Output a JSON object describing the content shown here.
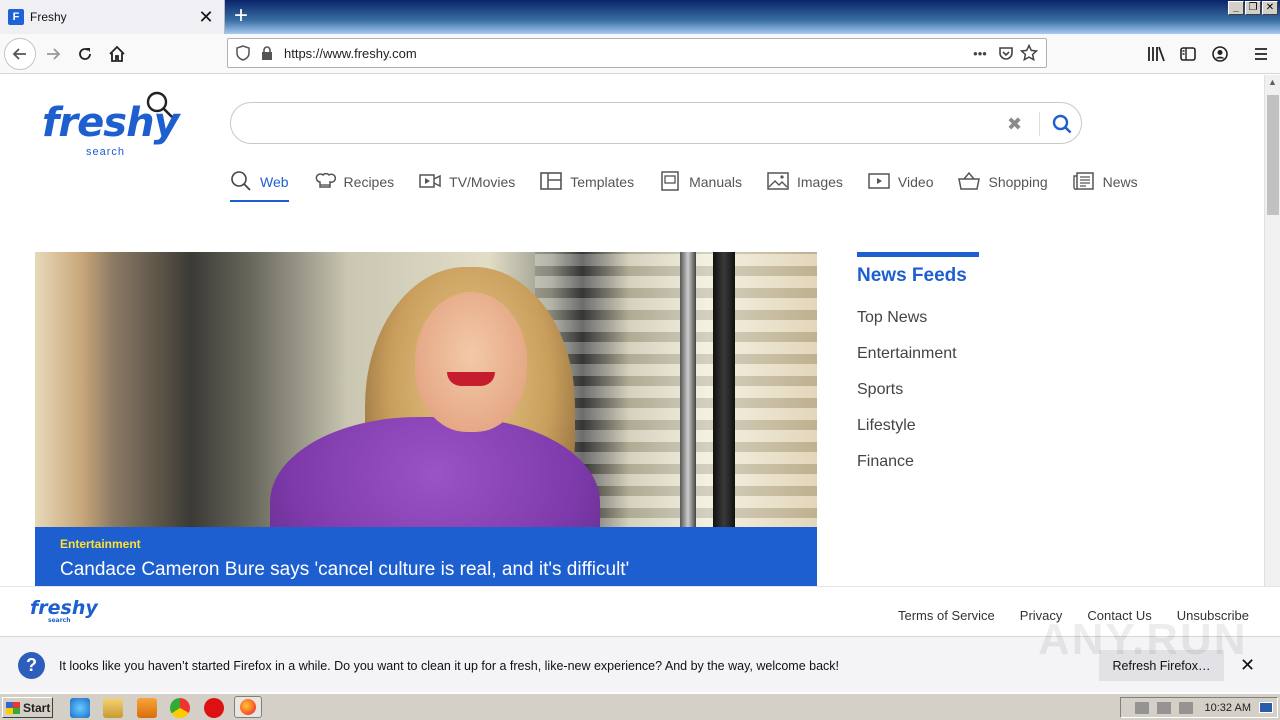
{
  "browser": {
    "tab_title": "Freshy",
    "tab_favicon": "F",
    "url": "https://www.freshy.com",
    "new_tab_symbol": "+",
    "close_symbol": "✕",
    "window_buttons": [
      "_",
      "❐",
      "✕"
    ]
  },
  "logo": {
    "word": "freshy",
    "sub": "search"
  },
  "search": {
    "value": "",
    "placeholder": ""
  },
  "categories": [
    {
      "label": "Web",
      "icon": "search-icon",
      "active": true
    },
    {
      "label": "Recipes",
      "icon": "chef-hat-icon"
    },
    {
      "label": "TV/Movies",
      "icon": "film-icon"
    },
    {
      "label": "Templates",
      "icon": "template-icon"
    },
    {
      "label": "Manuals",
      "icon": "manual-icon"
    },
    {
      "label": "Images",
      "icon": "image-icon"
    },
    {
      "label": "Video",
      "icon": "video-icon"
    },
    {
      "label": "Shopping",
      "icon": "shopping-basket-icon"
    },
    {
      "label": "News",
      "icon": "newspaper-icon"
    }
  ],
  "hero": {
    "category": "Entertainment",
    "title": "Candace Cameron Bure says 'cancel culture is real, and it's difficult'"
  },
  "news_feeds": {
    "title": "News Feeds",
    "items": [
      "Top News",
      "Entertainment",
      "Sports",
      "Lifestyle",
      "Finance"
    ]
  },
  "footer": {
    "logo": "freshy",
    "logo_sub": "search",
    "links": [
      "Terms of Service",
      "Privacy",
      "Contact Us",
      "Unsubscribe"
    ]
  },
  "notification": {
    "message": "It looks like you haven’t started Firefox in a while. Do you want to clean it up for a fresh, like-new experience? And by the way, welcome back!",
    "button": "Refresh Firefox…",
    "icon": "?"
  },
  "watermark": "ANY.RUN",
  "taskbar": {
    "start_label": "Start",
    "clock": "10:32 AM"
  },
  "colors": {
    "brand": "#1e5fd0",
    "caption_category": "#ffe034",
    "purple": "#8a3fb8"
  }
}
